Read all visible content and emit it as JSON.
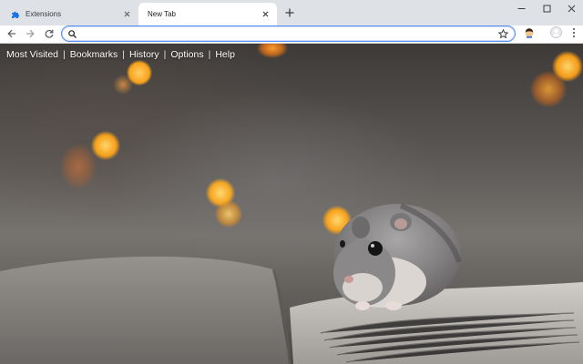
{
  "tabs": [
    {
      "title": "Extensions",
      "active": false,
      "icon": "puzzle-icon"
    },
    {
      "title": "New Tab",
      "active": true
    }
  ],
  "omnibox": {
    "value": "",
    "placeholder": ""
  },
  "nav": {
    "links": [
      "Most Visited",
      "Bookmarks",
      "History",
      "Options",
      "Help"
    ],
    "separator": "|"
  },
  "background": {
    "subject": "hamster-on-open-book",
    "accent": "#f7a21b"
  },
  "colors": {
    "tabstrip": "#dee1e6",
    "omnibox_border": "#5b8def",
    "link_text": "#ffffff"
  }
}
